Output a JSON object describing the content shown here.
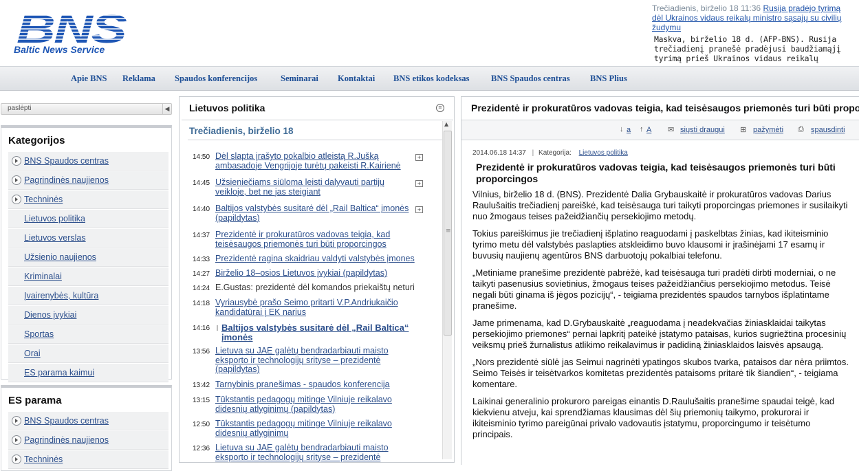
{
  "brand": {
    "logo_letters": "BNS",
    "name": "Baltic News Service"
  },
  "ticker": {
    "time": "Trečiadienis, birželio 18 11:36",
    "headline": "Rusija pradėjo tyrimą dėl Ukrainos vidaus reikalų ministro sąsajų su civilių žudymu",
    "body": "Maskva, birželio 18 d. (AFP-BNS). Rusija trečiadienį pranešė pradėjusi baudžiamąjį tyrimą prieš Ukrainos vidaus reikalų ministrą Arseną Avakovą ir"
  },
  "nav": [
    "Apie BNS",
    "Reklama",
    "Spaudos konferencijos",
    "Seminarai",
    "Kontaktai",
    "BNS etikos kodeksas",
    "BNS Spaudos centras",
    "BNS Plius"
  ],
  "sidebar": {
    "hide_label": "paslėpti",
    "categories_title": "Kategorijos",
    "categories": [
      {
        "label": "BNS Spaudos centras",
        "expandable": true
      },
      {
        "label": "Pagrindinės naujienos",
        "expandable": true
      },
      {
        "label": "Techninės",
        "expandable": true
      },
      {
        "label": "Lietuvos politika",
        "expandable": false
      },
      {
        "label": "Lietuvos verslas",
        "expandable": false
      },
      {
        "label": "Užsienio naujienos",
        "expandable": false
      },
      {
        "label": "Kriminalai",
        "expandable": false
      },
      {
        "label": "Įvairenybės, kultūra",
        "expandable": false
      },
      {
        "label": "Dienos įvykiai",
        "expandable": false
      },
      {
        "label": "Sportas",
        "expandable": false
      },
      {
        "label": "Orai",
        "expandable": false
      },
      {
        "label": "ES parama kaimui",
        "expandable": false
      }
    ],
    "es_title": "ES parama",
    "es_items": [
      {
        "label": "BNS Spaudos centras"
      },
      {
        "label": "Pagrindinės naujienos"
      },
      {
        "label": "Techninės"
      }
    ]
  },
  "news_panel": {
    "title": "Lietuvos politika",
    "date": "Trečiadienis, birželio 18",
    "items": [
      {
        "time": "14:50",
        "text": "Dėl slapta įrašyto pokalbio atleistą R.Jušką ambasadoje Vengrijoje turėtų pakeisti R.Kairienė",
        "plus": true
      },
      {
        "time": "14:45",
        "text": "Užsieniečiams siūloma leisti dalyvauti partijų veikloje, bet ne jas steigiant",
        "plus": true
      },
      {
        "time": "14:40",
        "text": "Baltijos valstybės susitarė dėl „Rail Baltica“ įmonės (papildytas)",
        "plus": true
      },
      {
        "time": "14:37",
        "text": "Prezidentė ir prokuratūros vadovas teigia, kad teisėsaugos priemonės turi būti proporcingos"
      },
      {
        "time": "14:33",
        "text": "Prezidentė ragina skaidriau valdyti valstybės įmones"
      },
      {
        "time": "14:27",
        "text": "Birželio 18–osios Lietuvos įvykiai (papildytas)"
      },
      {
        "time": "14:24",
        "text": "E.Gustas: prezidentė dėl komandos priekaištų neturi",
        "plain": true
      },
      {
        "time": "14:18",
        "text": "Vyriausybė prašo Seimo pritarti V.P.Andriukaičio kandidatūrai į EK narius"
      },
      {
        "time": "14:16",
        "text": "Baltijos valstybės susitarė dėl „Rail Baltica“ įmonės",
        "bold": true
      },
      {
        "time": "13:56",
        "text": "Lietuva su JAE galėtų bendradarbiauti maisto eksporto ir technologijų srityse – prezidentė (papildytas)"
      },
      {
        "time": "13:42",
        "text": "Tarnybinis pranešimas - spaudos konferencija"
      },
      {
        "time": "13:15",
        "text": "Tūkstantis pedagogų mitinge Vilniuje reikalavo didesnių atlyginimų (papildytas)"
      },
      {
        "time": "12:50",
        "text": "Tūkstantis pedagogų mitinge Vilniuje reikalavo didesnių atlyginimų"
      },
      {
        "time": "12:36",
        "text": "Lietuva su JAE galėtų bendradarbiauti maisto eksporto ir technologijų srityse – prezidentė"
      }
    ]
  },
  "article": {
    "panel_title": "Prezidentė ir prokuratūros vadovas teigia, kad teisėsaugos priemonės turi būti proporcingos",
    "toolbar": {
      "font_smaller": "a",
      "font_larger": "A",
      "send": "siųsti draugui",
      "bookmark": "pažymėti",
      "print": "spausdinti"
    },
    "meta_date": "2014.06.18 14:37",
    "meta_category_label": "Kategorija:",
    "meta_category": "Lietuvos politika",
    "headline": "Prezidentė ir prokuratūros vadovas teigia, kad teisėsaugos priemonės turi būti proporcingos",
    "paragraphs": [
      "Vilnius, birželio 18 d. (BNS). Prezidentė Dalia Grybauskaitė ir prokuratūros vadovas Darius Raulušaitis trečiadienį pareiškė, kad teisėsauga turi taikyti proporcingas priemones ir susilaikyti nuo žmogaus teises pažeidžiančių persekiojimo metodų.",
      "Tokius pareiškimus jie trečiadienį išplatino reaguodami į paskelbtas žinias, kad ikiteisminio tyrimo metu dėl valstybės paslapties atskleidimo buvo klausomi ir įrašinėjami 17 esamų ir buvusių naujienų agentūros BNS darbuotojų pokalbiai telefonu.",
      "„Metiniame pranešime prezidentė pabrėžė, kad teisėsauga turi pradėti dirbti moderniai, o ne taikyti pasenusius sovietinius, žmogaus teises pažeidžiančius persekiojimo metodus. Teisė negali būti ginama iš jėgos pozicijų“, - teigiama prezidentės spaudos tarnybos išplatintame pranešime.",
      "Jame primenama, kad D.Grybauskaitė „reaguodama į neadekvačias žiniasklaidai taikytas persekiojimo priemones“ pernai lapkritį pateikė įstatymo pataisas, kurios sugriežtina procesinių veiksmų prieš žurnalistus atlikimo reikalavimus ir padidiną žiniasklaidos laisvės apsaugą.",
      "„Nors prezidentė siūlė jas Seimui nagrinėti ypatingos skubos tvarka, pataisos dar nėra priimtos. Seimo Teisės ir teisėtvarkos komitetas prezidentės pataisoms pritarė tik šiandien“, - teigiama komentare.",
      "Laikinai generalinio prokuroro pareigas einantis D.Raulušaitis pranešime spaudai teigė, kad kiekvienu atveju, kai sprendžiamas klausimas dėl šių priemonių taikymo, prokurorai ir ikiteisminio tyrimo pareigūnai privalo vadovautis įstatymu, proporcingumo ir teisėtumo principais."
    ]
  },
  "colors": {
    "link": "#2c4f8c",
    "logo_blue": "#1f57b5",
    "nav_text": "#1e4f96",
    "date_blue": "#3f6b96"
  }
}
